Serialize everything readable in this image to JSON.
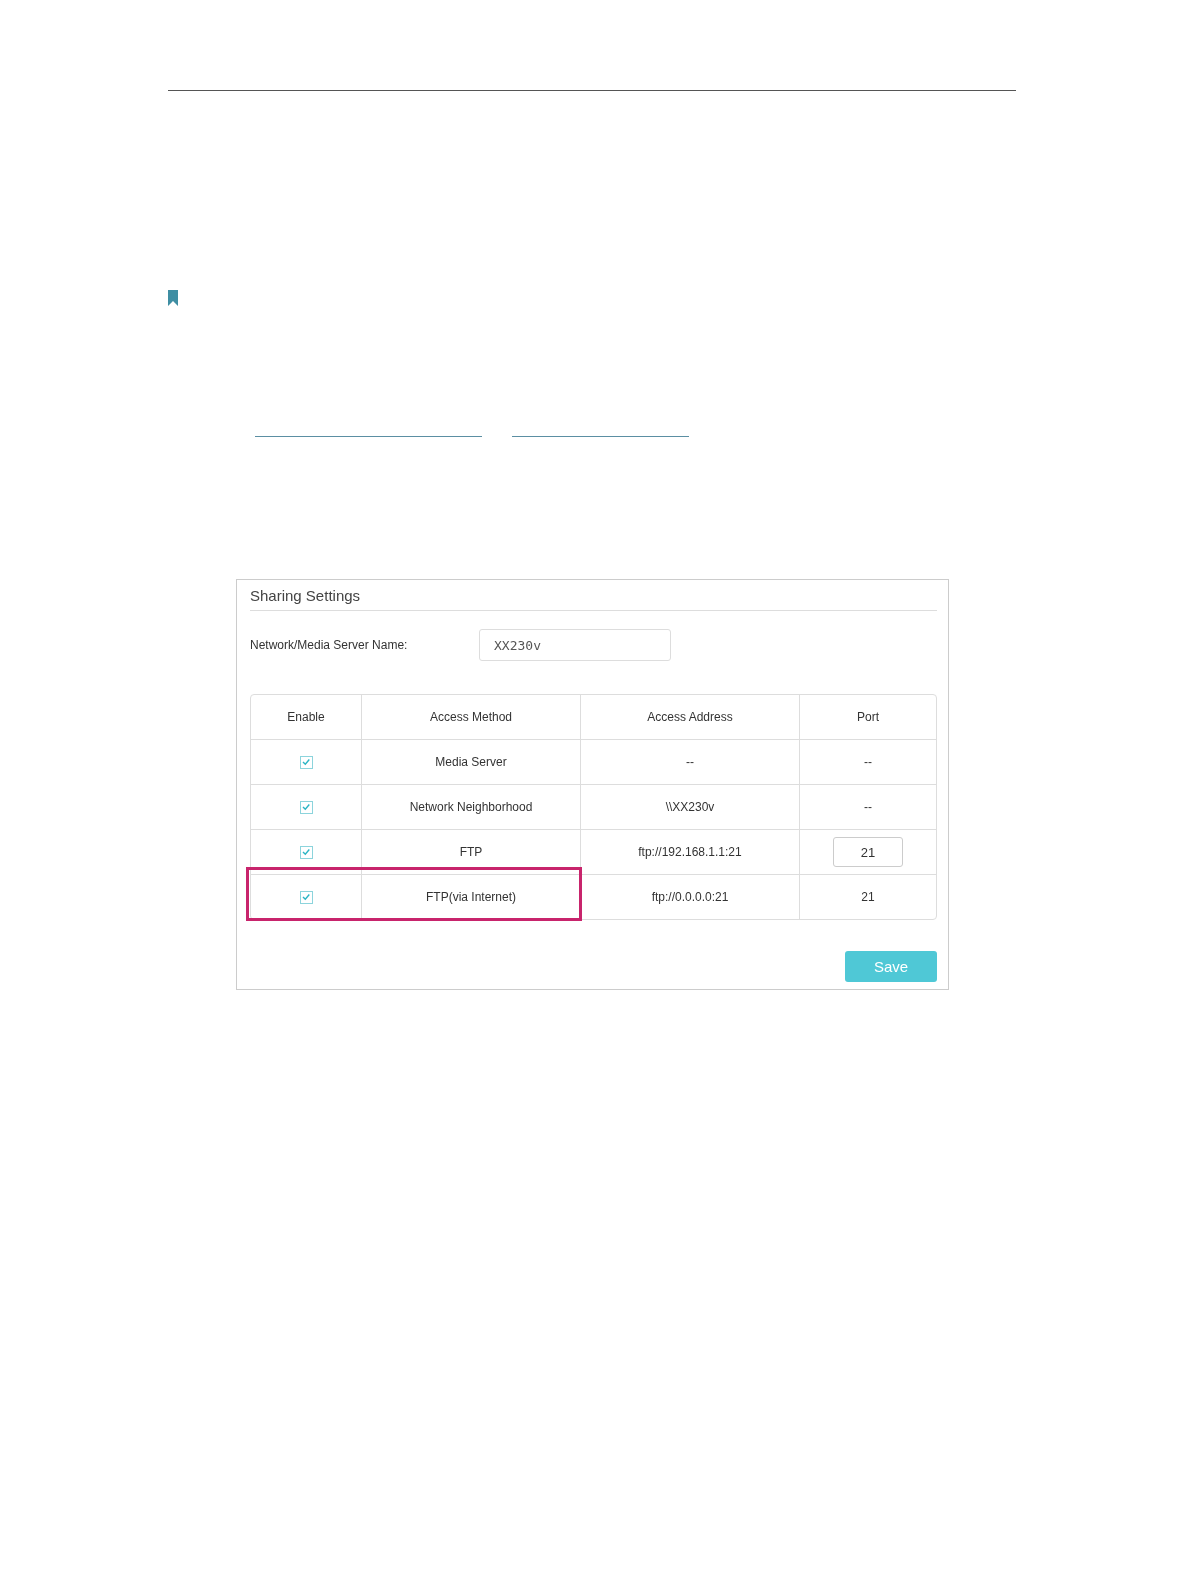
{
  "panel": {
    "title": "Sharing Settings",
    "server_name": {
      "label": "Network/Media Server Name:",
      "value": "XX230v"
    },
    "table": {
      "columns": [
        "Enable",
        "Access Method",
        "Access Address",
        "Port"
      ],
      "rows": [
        {
          "enabled": true,
          "method": "Media Server",
          "address": "--",
          "port": {
            "kind": "text",
            "value": "--"
          },
          "highlighted": false
        },
        {
          "enabled": true,
          "method": "Network Neighborhood",
          "address": "\\\\XX230v",
          "port": {
            "kind": "text",
            "value": "--"
          },
          "highlighted": false
        },
        {
          "enabled": true,
          "method": "FTP",
          "address": "ftp://192.168.1.1:21",
          "port": {
            "kind": "field",
            "value": "21"
          },
          "highlighted": false
        },
        {
          "enabled": true,
          "method": "FTP(via Internet)",
          "address": "ftp://0.0.0.0:21",
          "port": {
            "kind": "text",
            "value": "21"
          },
          "highlighted": true
        }
      ]
    },
    "buttons": [
      "Save"
    ]
  }
}
